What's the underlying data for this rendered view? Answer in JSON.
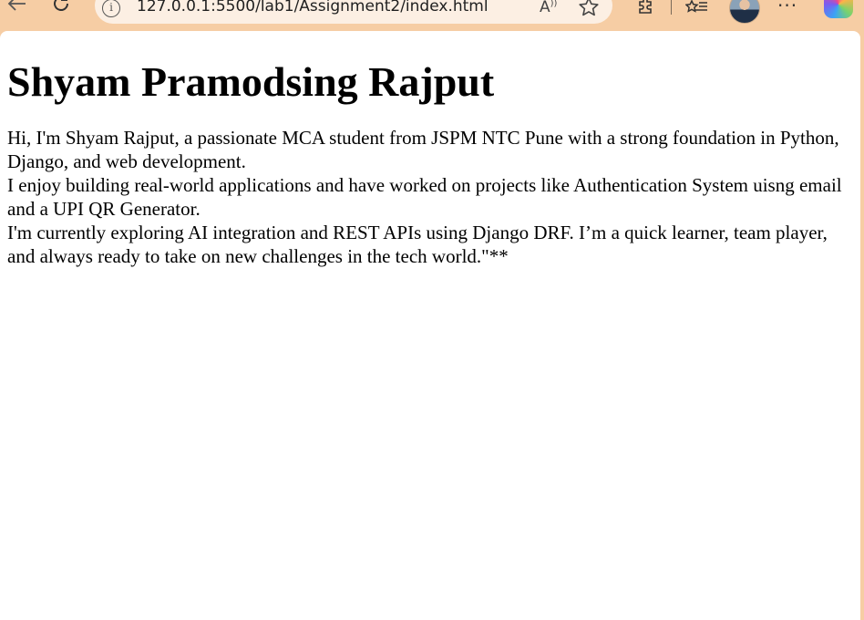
{
  "browser": {
    "url": "127.0.0.1:5500/lab1/Assignment2/index.html",
    "read_aloud_label": "Ȃ̒",
    "icons": {
      "back": "back-arrow-icon",
      "refresh": "refresh-icon",
      "info": "site-info-icon",
      "read_aloud": "read-aloud-icon",
      "favorite": "star-icon",
      "extensions": "puzzle-icon",
      "favorites_list": "favorites-list-icon",
      "more": "more-icon",
      "copilot": "copilot-icon"
    },
    "theme_color": "#f6cda4"
  },
  "page": {
    "heading": "Shyam Pramodsing Rajput",
    "lines": [
      "Hi, I'm Shyam Rajput, a passionate MCA student from JSPM NTC Pune with a strong foundation in Python, Django, and web development.",
      "I enjoy building real-world applications and have worked on projects like Authentication System uisng email and a UPI QR Generator.",
      "I'm currently exploring AI integration and REST APIs using Django DRF. I’m a quick learner, team player, and always ready to take on new challenges in the tech world.\"**"
    ]
  }
}
